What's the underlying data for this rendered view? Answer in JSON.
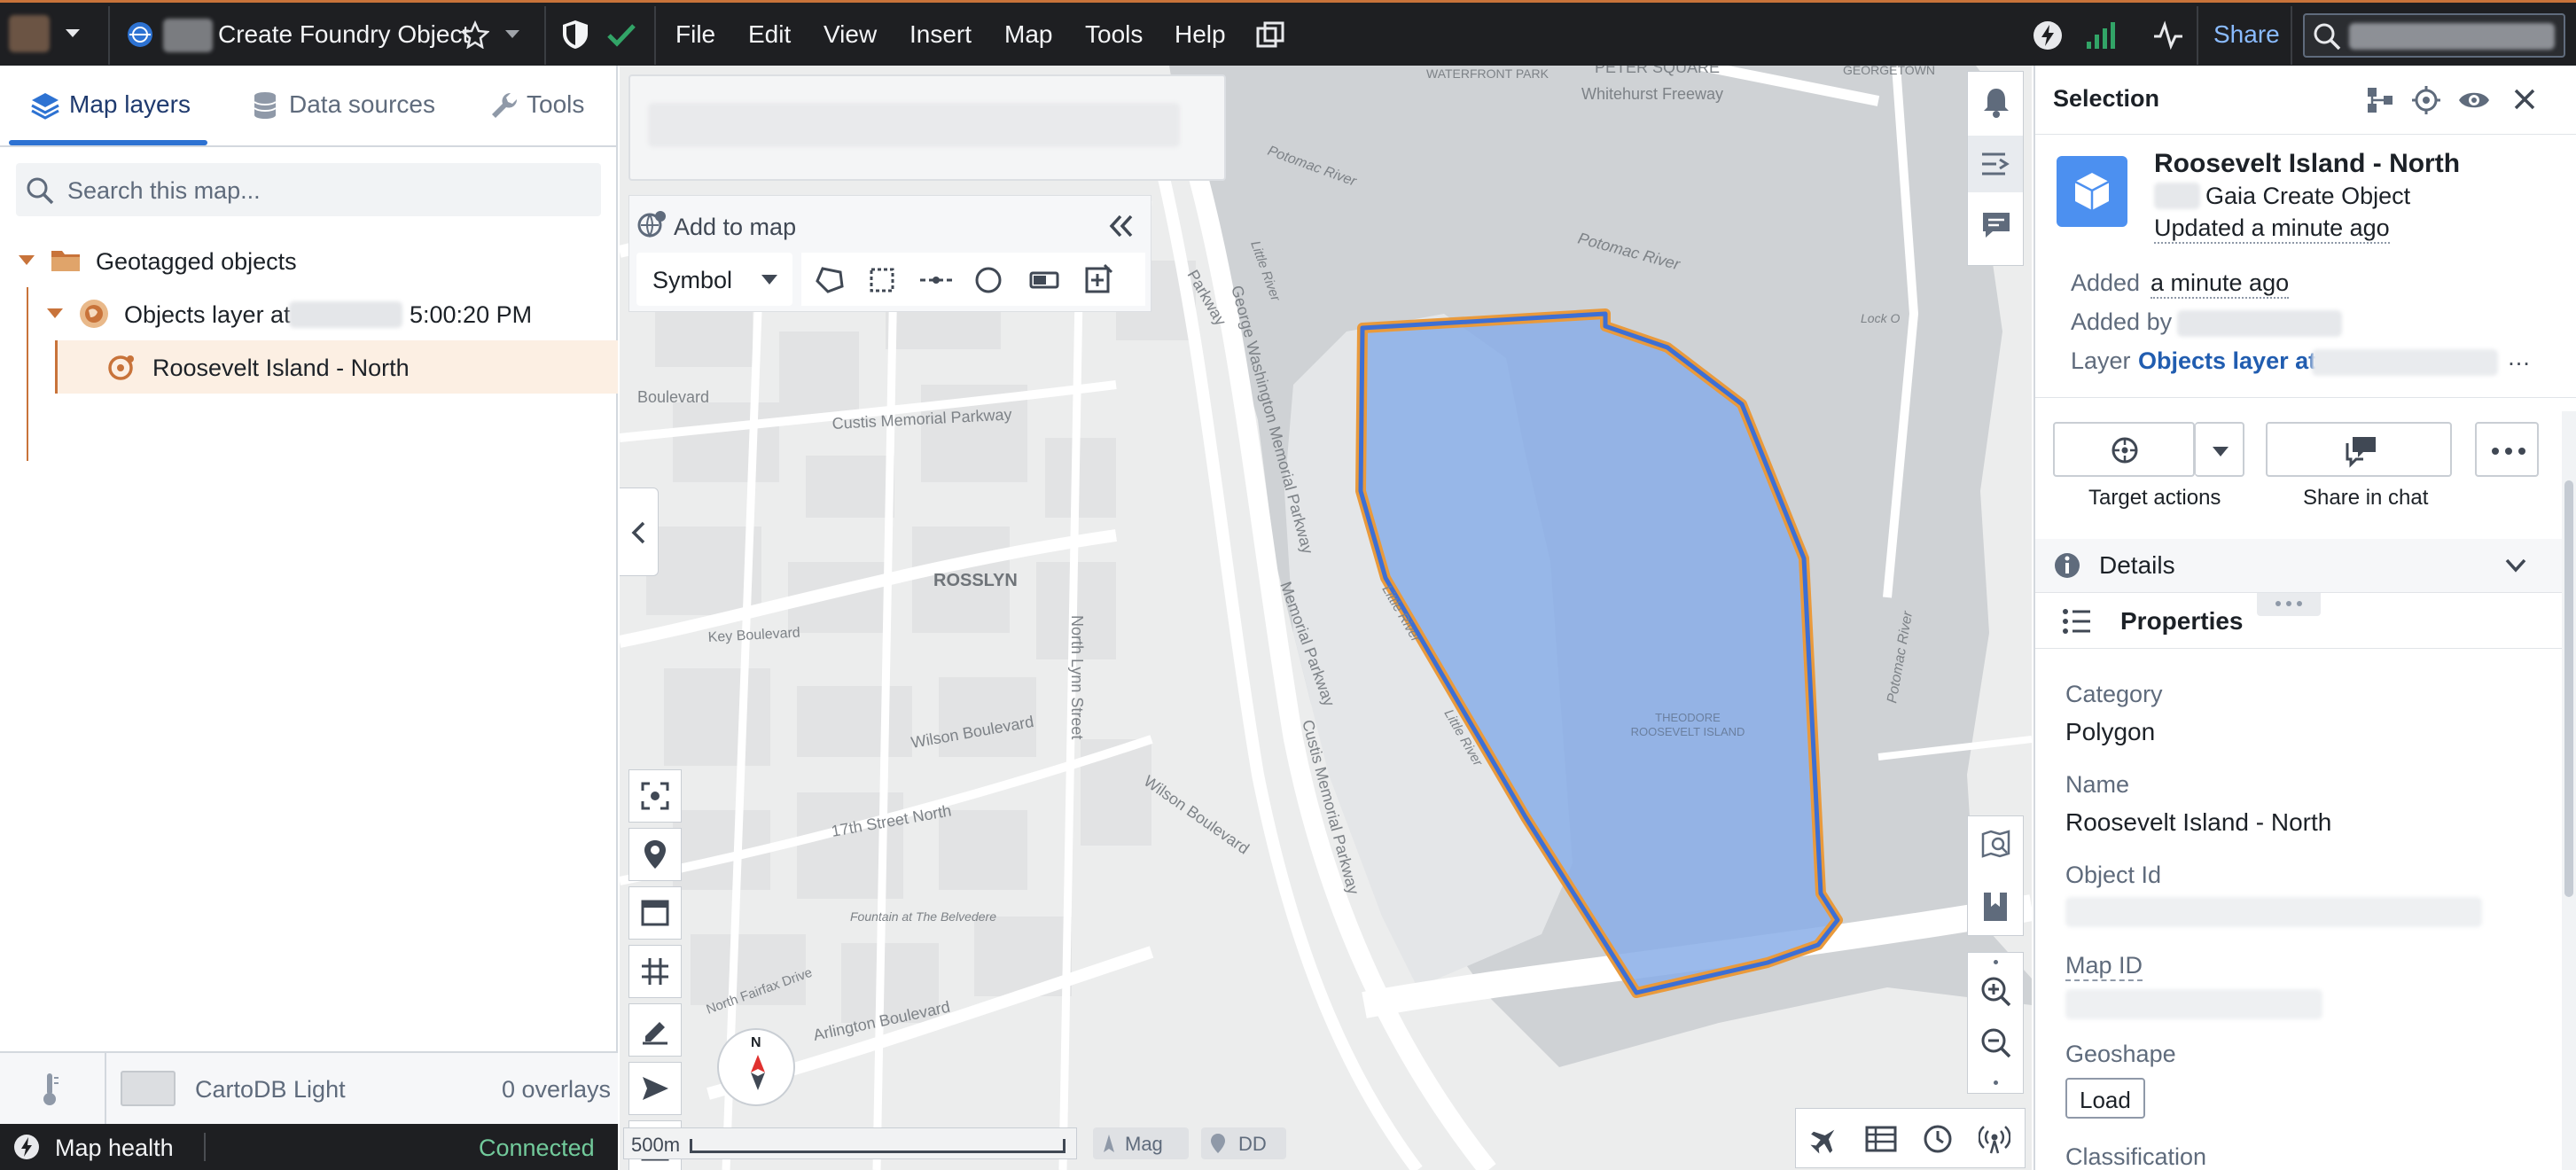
{
  "topbar": {
    "title": "Create Foundry Object",
    "menu": [
      "File",
      "Edit",
      "View",
      "Insert",
      "Map",
      "Tools",
      "Help"
    ],
    "share_label": "Share"
  },
  "left_panel": {
    "tabs": [
      {
        "label": "Map layers",
        "active": true
      },
      {
        "label": "Data sources",
        "active": false
      },
      {
        "label": "Tools",
        "active": false
      }
    ],
    "search_placeholder": "Search this map...",
    "tree": {
      "group_label": "Geotagged objects",
      "layer_prefix": "Objects layer at",
      "layer_time": "5:00:20 PM",
      "object_label": "Roosevelt Island - North"
    },
    "basemap": {
      "name": "CartoDB Light",
      "overlays": "0 overlays"
    },
    "status": {
      "label": "Map health",
      "state": "Connected"
    }
  },
  "map": {
    "add_to_map_label": "Add to map",
    "symbol_label": "Symbol",
    "scale_label": "500m",
    "mag_label": "Mag",
    "dd_label": "DD",
    "compass_label": "N",
    "place_labels": {
      "rosslyn": "ROSSLYN",
      "peter_square": "PETER SQUARE",
      "whitehurst": "Whitehurst Freeway",
      "waterfront": "WATERFRONT PARK",
      "georgetown": "GEORGETOWN",
      "potomac_river": "Potomac River",
      "little_river": "Little River",
      "gw_parkway": "George Washington Memorial Parkway",
      "custis_parkway": "Custis Memorial Parkway",
      "wilson_blvd": "Wilson Boulevard",
      "street_17": "17th Street North",
      "key_blvd": "Key Boulevard",
      "n_lynn": "North Lynn Street",
      "arlington_blvd": "Arlington Boulevard",
      "island_label": "THEODORE ROOSEVELT ISLAND",
      "lock": "Lock O",
      "parkway_short": "Parkway",
      "memorial_parkway": "Memorial Parkway",
      "boulevard": "Boulevard",
      "fairfax": "North Fairfax Drive",
      "fountain": "Fountain at The Belvedere"
    },
    "colors": {
      "polygon_fill": "#8aaee8",
      "polygon_stroke": "#3d6fd4",
      "polygon_outline": "#e99a3c"
    }
  },
  "selection": {
    "header": "Selection",
    "title": "Roosevelt Island - North",
    "subtitle": "Gaia Create Object",
    "updated": "Updated a minute ago",
    "added_label": "Added",
    "added_value": "a minute ago",
    "added_by_label": "Added by",
    "layer_label": "Layer",
    "layer_value": "Objects layer at",
    "target_actions": "Target actions",
    "share_in_chat": "Share in chat",
    "details_label": "Details",
    "properties_label": "Properties",
    "properties": {
      "category_label": "Category",
      "category_value": "Polygon",
      "name_label": "Name",
      "name_value": "Roosevelt Island - North",
      "object_id_label": "Object Id",
      "map_id_label": "Map ID",
      "geoshape_label": "Geoshape",
      "load_label": "Load",
      "classification_label": "Classification"
    }
  }
}
